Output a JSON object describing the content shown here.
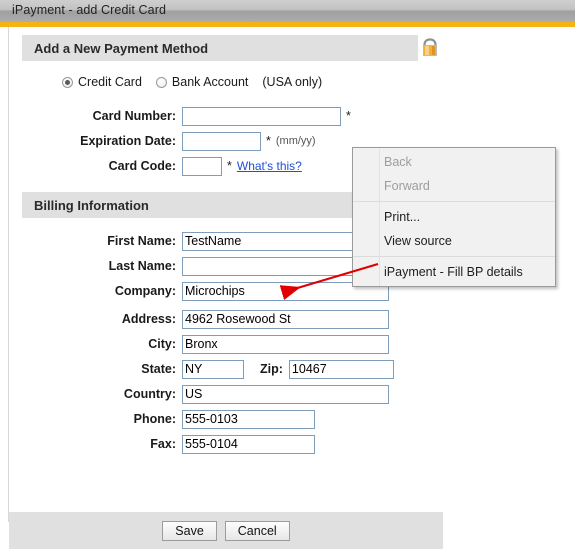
{
  "window": {
    "title": "iPayment - add Credit Card"
  },
  "sections": {
    "payment_method": {
      "heading": "Add a New Payment Method",
      "lock_icon": "padlock-icon"
    },
    "billing": {
      "heading": "Billing Information"
    }
  },
  "payment_type": {
    "options": [
      {
        "label": "Credit Card",
        "selected": true
      },
      {
        "label": "Bank Account",
        "selected": false
      }
    ],
    "note": "(USA only)"
  },
  "card_fields": [
    {
      "label": "Card Number:",
      "value": "",
      "required_mark": "*",
      "hint": ""
    },
    {
      "label": "Expiration Date:",
      "value": "",
      "required_mark": "*",
      "hint": "(mm/yy)"
    },
    {
      "label": "Card Code:",
      "value": "",
      "required_mark": "*",
      "hint": "",
      "link": "What's this?"
    }
  ],
  "billing_fields": {
    "first_name": {
      "label": "First Name:",
      "value": "TestName"
    },
    "last_name": {
      "label": "Last Name:",
      "value": ""
    },
    "company": {
      "label": "Company:",
      "value": "Microchips"
    },
    "address": {
      "label": "Address:",
      "value": "4962 Rosewood St"
    },
    "city": {
      "label": "City:",
      "value": "Bronx"
    },
    "state": {
      "label": "State:",
      "value": "NY"
    },
    "zip": {
      "label": "Zip:",
      "value": "10467"
    },
    "country": {
      "label": "Country:",
      "value": "US"
    },
    "phone": {
      "label": "Phone:",
      "value": "555-0103"
    },
    "fax": {
      "label": "Fax:",
      "value": "555-0104"
    }
  },
  "footer": {
    "save_label": "Save",
    "cancel_label": "Cancel"
  },
  "context_menu": {
    "items": [
      {
        "label": "Back",
        "enabled": false
      },
      {
        "label": "Forward",
        "enabled": false
      },
      {
        "label": "Print...",
        "enabled": true
      },
      {
        "label": "View source",
        "enabled": true
      },
      {
        "label": "iPayment - Fill BP details",
        "enabled": true
      }
    ]
  },
  "annotation": {
    "arrow_color": "#e00000"
  },
  "colors": {
    "accent_orange": "#f5b317",
    "section_bar": "#e0e0e0",
    "input_border": "#7f9db9",
    "link_blue": "#1f4fd8"
  }
}
